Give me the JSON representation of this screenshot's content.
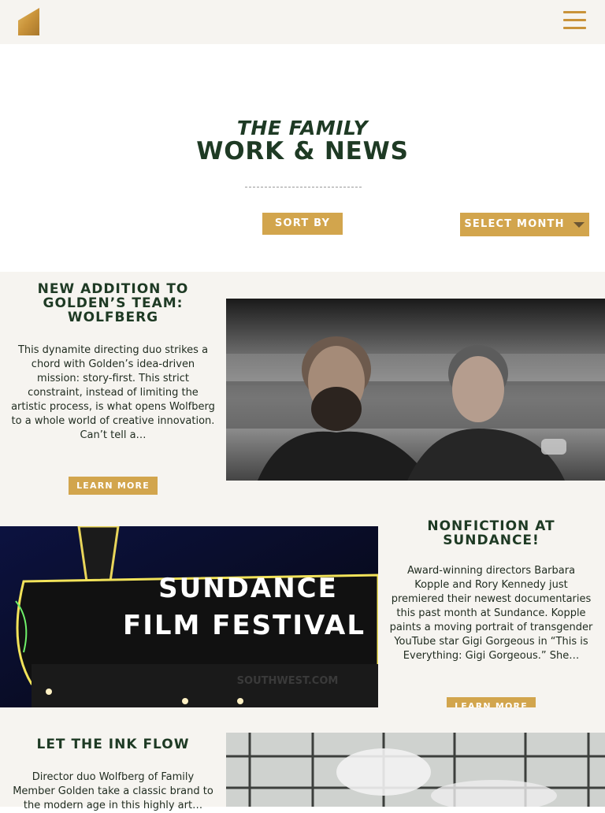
{
  "header": {
    "logo_icon": "gold-house-logo",
    "menu_icon": "hamburger-menu-icon",
    "accent_color": "#c9933a"
  },
  "hero": {
    "kicker": "THE FAMILY",
    "title": "WORK & NEWS",
    "sort_label": "SORT BY",
    "month_label": "SELECT MONTH",
    "button_color": "#d2a54d"
  },
  "posts": [
    {
      "title": "NEW ADDITION TO GOLDEN’S TEAM: WOLFBERG",
      "excerpt": "This dynamite directing duo strikes a chord with Golden’s idea-driven mission: story-first. This strict constraint, instead of limiting the artistic process, is what opens Wolfberg to a whole world of creative innovation. Can’t tell a…",
      "cta": "LEARN MORE"
    },
    {
      "title": "NONFICTION AT SUNDANCE!",
      "excerpt": "Award-winning directors Barbara Kopple and Rory Kennedy just premiered their newest documentaries this past month at Sundance. Kopple paints a moving portrait of transgender YouTube star Gigi Gorgeous in “This is Everything: Gigi Gorgeous.” She…",
      "cta": "LEARN MORE",
      "image_text_1": "SUNDANCE",
      "image_text_2": "FILM FESTIVAL",
      "image_text_3": "SOUTHWEST.COM"
    },
    {
      "title": "LET THE INK FLOW",
      "excerpt": "Director duo Wolfberg of Family Member Golden take a classic brand to the modern age in this highly art…"
    }
  ]
}
